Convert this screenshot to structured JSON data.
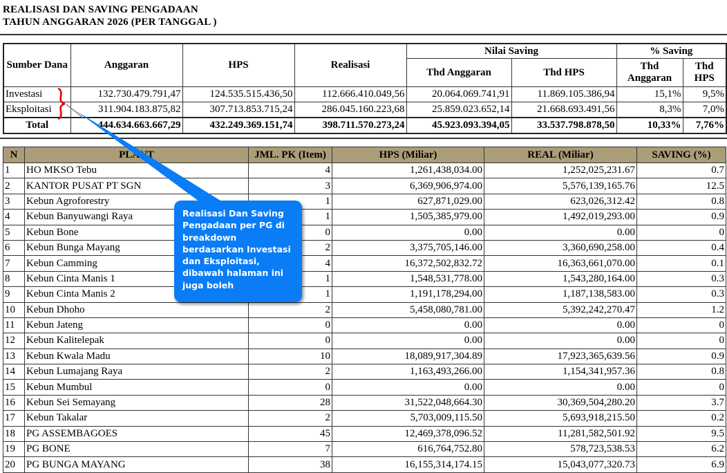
{
  "title_line1": "REALISASI DAN SAVING PENGADAAN",
  "title_line2": "TAHUN ANGGARAN 2026  (PER TANGGAL )",
  "summary": {
    "headers": {
      "sumber_dana": "Sumber Dana",
      "anggaran": "Anggaran",
      "hps": "HPS",
      "realisasi": "Realisasi",
      "nilai_saving": "Nilai Saving",
      "ns_thd_anggaran": "Thd Anggaran",
      "ns_thd_hps": "Thd HPS",
      "pct_saving": "% Saving",
      "ps_thd_anggaran": "Thd Anggaran",
      "ps_thd_hps": "Thd HPS"
    },
    "rows": [
      {
        "sumber": "Investasi",
        "anggaran": "132.730.479.791,47",
        "hps": "124.535.515.436,50",
        "realisasi": "112.666.410.049,56",
        "ns_anggaran": "20.064.069.741,91",
        "ns_hps": "11.869.105.386,94",
        "ps_anggaran": "15,1%",
        "ps_hps": "9,5%"
      },
      {
        "sumber": "Eksploitasi",
        "anggaran": "311.904.183.875,82",
        "hps": "307.713.853.715,24",
        "realisasi": "286.045.160.223,68",
        "ns_anggaran": "25.859.023.652,14",
        "ns_hps": "21.668.693.491,56",
        "ps_anggaran": "8,3%",
        "ps_hps": "7,0%"
      },
      {
        "sumber": "Total",
        "anggaran": "444.634.663.667,29",
        "hps": "432.249.369.151,74",
        "realisasi": "398.711.570.273,24",
        "ns_anggaran": "45.923.093.394,05",
        "ns_hps": "33.537.798.878,50",
        "ps_anggaran": "10,33%",
        "ps_hps": "7,76%"
      }
    ]
  },
  "detail": {
    "headers": [
      "N",
      "PLANT",
      "JML. PK (Item)",
      "HPS (Miliar)",
      "REAL (Miliar)",
      "SAVING (%)"
    ],
    "header_color": "#ab9d78",
    "rows": [
      [
        "1",
        "HO MKSO Tebu",
        "4",
        "1,261,438,034.00",
        "1,252,025,231.67",
        "0.7"
      ],
      [
        "2",
        "KANTOR PUSAT PT SGN",
        "3",
        "6,369,906,974.00",
        "5,576,139,165.76",
        "12.5"
      ],
      [
        "3",
        "Kebun Agroforestry",
        "1",
        "627,871,029.00",
        "623,026,312.42",
        "0.8"
      ],
      [
        "4",
        "Kebun Banyuwangi Raya",
        "1",
        "1,505,385,979.00",
        "1,492,019,293.00",
        "0.9"
      ],
      [
        "5",
        "Kebun Bone",
        "0",
        "0.00",
        "0.00",
        "0"
      ],
      [
        "6",
        "Kebun Bunga Mayang",
        "2",
        "3,375,705,146.00",
        "3,360,690,258.00",
        "0.4"
      ],
      [
        "7",
        "Kebun Camming",
        "4",
        "16,372,502,832.72",
        "16,363,661,070.00",
        "0.1"
      ],
      [
        "8",
        "Kebun Cinta Manis 1",
        "1",
        "1,548,531,778.00",
        "1,543,280,164.00",
        "0.3"
      ],
      [
        "9",
        "Kebun Cinta Manis 2",
        "1",
        "1,191,178,294.00",
        "1,187,138,583.00",
        "0.3"
      ],
      [
        "10",
        "Kebun Dhoho",
        "2",
        "5,458,080,781.00",
        "5,392,242,270.47",
        "1.2"
      ],
      [
        "11",
        "Kebun Jateng",
        "0",
        "0.00",
        "0.00",
        "0"
      ],
      [
        "12",
        "Kebun Kalitelepak",
        "0",
        "0.00",
        "0.00",
        "0"
      ],
      [
        "13",
        "Kebun Kwala Madu",
        "10",
        "18,089,917,304.89",
        "17,923,365,639.56",
        "0.9"
      ],
      [
        "14",
        "Kebun Lumajang Raya",
        "2",
        "1,163,493,266.00",
        "1,154,341,957.36",
        "0.8"
      ],
      [
        "15",
        "Kebun Mumbul",
        "0",
        "0.00",
        "0.00",
        "0"
      ],
      [
        "16",
        "Kebun Sei Semayang",
        "28",
        "31,522,048,664.30",
        "30,369,504,280.20",
        "3.7"
      ],
      [
        "17",
        "Kebun Takalar",
        "2",
        "5,703,009,115.50",
        "5,693,918,215.50",
        "0.2"
      ],
      [
        "18",
        "PG ASSEMBAGOES",
        "45",
        "12,469,378,096.52",
        "11,281,582,501.92",
        "9.5"
      ],
      [
        "19",
        "PG BONE",
        "7",
        "616,764,752.80",
        "578,723,538.53",
        "6.2"
      ],
      [
        "20",
        "PG BUNGA MAYANG",
        "38",
        "16,155,314,174.15",
        "15,043,077,320.73",
        "6.9"
      ]
    ]
  },
  "annotation": {
    "text": "Realisasi Dan Saving Pengadaan per PG di breakdown berdasarkan Investasi dan Eksploitasi, dibawah halaman ini juga boleh",
    "color": "#0a7cf5",
    "brace_color": "#e00000"
  }
}
